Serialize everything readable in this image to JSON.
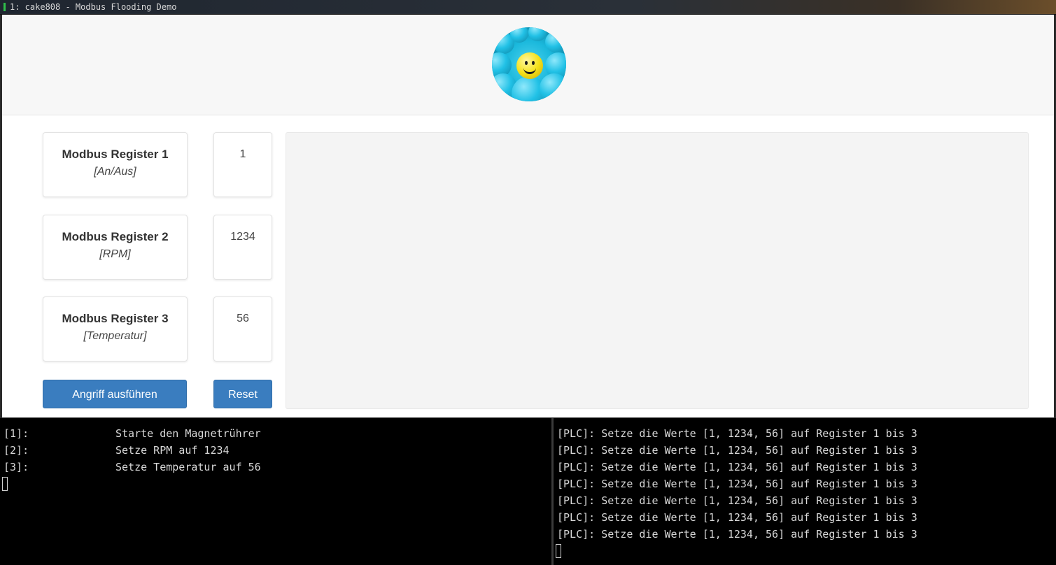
{
  "window": {
    "title": "1: cake808 - Modbus Flooding Demo"
  },
  "header": {
    "logo_icon": "smiley-crowd-logo-icon"
  },
  "registers": [
    {
      "name": "Modbus Register 1",
      "unit": "[An/Aus]",
      "value": "1"
    },
    {
      "name": "Modbus Register 2",
      "unit": "[RPM]",
      "value": "1234"
    },
    {
      "name": "Modbus Register 3",
      "unit": "[Temperatur]",
      "value": "56"
    }
  ],
  "buttons": {
    "attack_label": "Angriff ausführen",
    "reset_label": "Reset"
  },
  "terminal_left": {
    "lines": [
      {
        "tag": "[1]:",
        "text": "Starte den Magnetrührer"
      },
      {
        "tag": "[2]:",
        "text": "Setze RPM auf 1234"
      },
      {
        "tag": "[3]:",
        "text": "Setze Temperatur auf 56"
      }
    ]
  },
  "terminal_right": {
    "lines": [
      "[PLC]: Setze die Werte [1, 1234, 56] auf Register 1 bis 3",
      "[PLC]: Setze die Werte [1, 1234, 56] auf Register 1 bis 3",
      "[PLC]: Setze die Werte [1, 1234, 56] auf Register 1 bis 3",
      "[PLC]: Setze die Werte [1, 1234, 56] auf Register 1 bis 3",
      "[PLC]: Setze die Werte [1, 1234, 56] auf Register 1 bis 3",
      "[PLC]: Setze die Werte [1, 1234, 56] auf Register 1 bis 3",
      "[PLC]: Setze die Werte [1, 1234, 56] auf Register 1 bis 3"
    ]
  },
  "colors": {
    "button_blue": "#3a7dbf",
    "terminal_bg": "#000000",
    "terminal_fg": "#d8d8d8",
    "workspace_marker": "#2fbf4a"
  }
}
